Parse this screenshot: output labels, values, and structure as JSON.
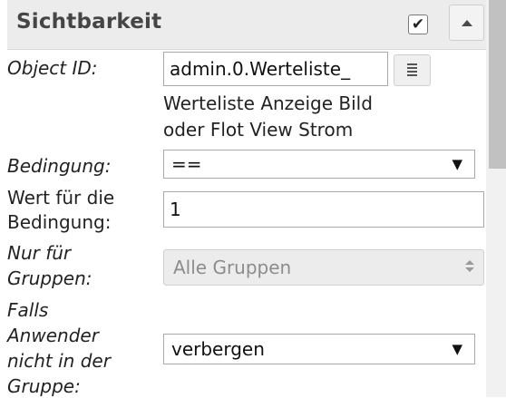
{
  "header": {
    "title": "Sichtbarkeit",
    "checkbox_glyph": "✔",
    "checkbox_checked": true,
    "collapse_icon": "triangle-up-icon"
  },
  "fields": {
    "object_id": {
      "label": "Object ID:",
      "value": "admin.0.Werteliste_",
      "description_line1": "Werteliste Anzeige Bild",
      "description_line2": "oder Flot View Strom",
      "select_button_icon": "document-list-icon"
    },
    "condition": {
      "label": "Bedingung:",
      "value": "==",
      "arrow": "▼"
    },
    "condition_value": {
      "label_line1": "Wert für die",
      "label_line2": "Bedingung:",
      "value": "1"
    },
    "only_for_groups": {
      "label_line1": "Nur für",
      "label_line2": "Gruppen:",
      "value": "Alle Gruppen"
    },
    "if_user_not_in_group": {
      "label_line1": "Falls",
      "label_line2": "Anwender",
      "label_line3": "nicht in der",
      "label_line4": "Gruppe:",
      "value": "verbergen",
      "arrow": "▼"
    }
  }
}
